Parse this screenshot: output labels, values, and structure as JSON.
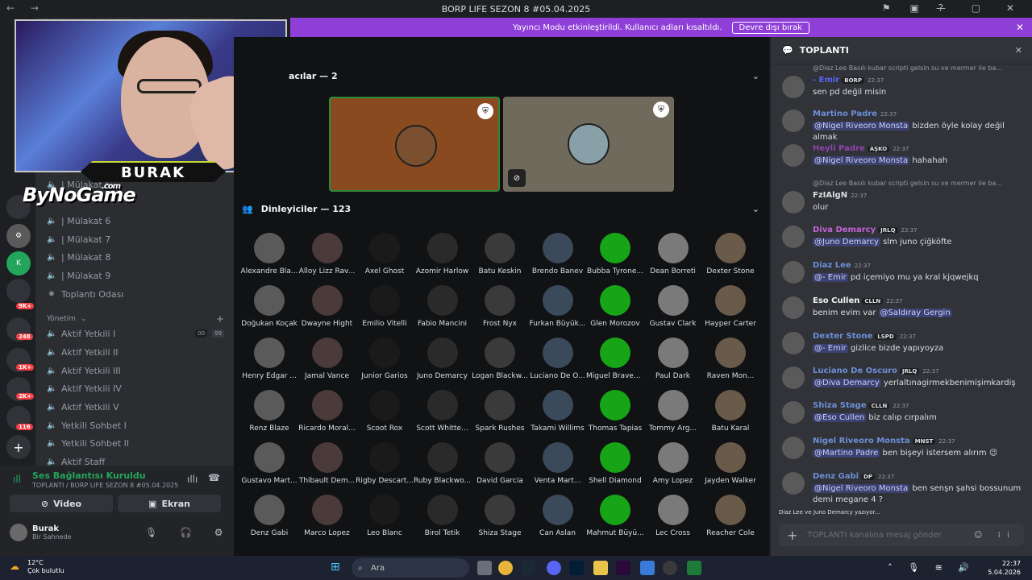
{
  "window": {
    "title": "BORP LIFE SEZON 8 #05.04.2025"
  },
  "banner": {
    "text": "Yayıncı Modu etkinleştirildi. Kullanıcı adları kısaltıldı.",
    "button": "Devre dışı bırak"
  },
  "servers": {
    "badges": [
      "9K+",
      "248",
      "1K+",
      "2K+",
      "116"
    ]
  },
  "channels": {
    "voice_items": [
      "| Mülakat 6",
      "| Mülakat 7",
      "| Mülakat 8",
      "| Mülakat 9",
      "Toplantı Odası"
    ],
    "category": "Yönetim",
    "mgmt_items": [
      "Aktif Yetkili I",
      "Aktif Yetkili II",
      "Aktif Yetkili III",
      "Aktif Yetkili IV",
      "Aktif Yetkili V",
      "Yetkili Sohbet I",
      "Yetkili Sohbet II",
      "Aktif Staff"
    ],
    "counters": [
      "00",
      "99"
    ],
    "partial_item": "| Mülakat 5"
  },
  "overlay": {
    "cam_name": "BURAK",
    "logo": "ByNoGame",
    "logo_suffix": ".com"
  },
  "voice": {
    "status": "Ses Bağlantısı Kuruldu",
    "channel": "TOPLANTI / BORP LIFE SEZON 8 #05.04.2025",
    "video_label": "Video",
    "screen_label": "Ekran",
    "user_name": "Burak",
    "user_status": "Bir Sahnede"
  },
  "stage": {
    "speakers_header": "acılar — 2",
    "listeners_header": "Dinleyiciler — 123",
    "listeners": [
      "Alexandre Bla...",
      "Alloy Lizz Rav...",
      "Axel Ghost",
      "Azomir Harlow",
      "Batu Keskin",
      "Brendo Banev",
      "Bubba Tyrone...",
      "Dean Borreti",
      "Dexter Stone",
      "Doğukan Koçak",
      "Dwayne Hight",
      "Emilio Vitelli",
      "Fabio Mancini",
      "Frost Nyx",
      "Furkan Büyük...",
      "Glen Morozov",
      "Gustav Clark",
      "Hayper Carter",
      "Henry Edgar ...",
      "Jamal Vance",
      "Junior Garios",
      "Juno Demarcy",
      "Logan Blackw...",
      "Luciano De O...",
      "Miguel Braven...",
      "Paul Dark",
      "Raven Mon...",
      "Renz Blaze",
      "Ricardo Moral...",
      "Scoot Rox",
      "Scott Whitte...",
      "Spark Rushes",
      "Takami Willims",
      "Thomas Tapias",
      "Tommy Arg...",
      "Batu Karal",
      "Gustavo Mart...",
      "Thibault Dem...",
      "Rigby Descart...",
      "Ruby Blackwo...",
      "David Garcia",
      "Venta Mart...",
      "Shell Diamond",
      "Amy Lopez",
      "Jayden Walker",
      "Denz Gabi",
      "Marco Lopez",
      "Leo Blanc",
      "Birol Tetik",
      "Shiza Stage",
      "Can Aslan",
      "Mahmut Büyü...",
      "Lec Cross",
      "Reacher Cole"
    ]
  },
  "chat": {
    "title": "TOPLANTI",
    "messages": [
      {
        "reply": "@Diaz Lee Basılı kubar scripti gelsin su ve mermer ile ba...",
        "name": "- Emir",
        "tag": "BORP",
        "time": "22:37",
        "text": "sen pd değil misin",
        "color": "#5865f2"
      },
      {
        "name": "Martino Padre",
        "time": "22:37",
        "mention": "@Nigel Riveoro Monsta",
        "text": " bizden öyle kolay değil almak",
        "color": "#6c8fd8"
      },
      {
        "name": "Heyli Padre",
        "tag": "AŞKO",
        "time": "22:37",
        "mention": "@Nigel Riveoro Monsta",
        "text": " hahahah",
        "color": "#8e44ad"
      },
      {
        "reply": "@Diaz Lee Basılı kubar scripti gelsin su ve mermer ile ba...",
        "name": "FzIAlgN",
        "time": "22:37",
        "text": "olur",
        "color": "#dbdee1"
      },
      {
        "name": "Diva Demarcy",
        "tag": "JRLQ",
        "time": "22:37",
        "mention": "@Juno Demarcy",
        "text": " slm juno çiğköfte",
        "color": "#c264d6"
      },
      {
        "name": "Diaz Lee",
        "time": "22:37",
        "mention": "@- Emir",
        "text": " pd içemiyo mu ya kral kjqwejkq",
        "color": "#6c8fd8"
      },
      {
        "name": "Eso Cullen",
        "tag": "CLLN",
        "time": "22:37",
        "text": "benim evim var ",
        "mention2": "@Saldıray Gergin",
        "color": "#f2f3f5"
      },
      {
        "name": "Dexter Stone",
        "tag": "LSPD",
        "time": "22:37",
        "mention": "@- Emir",
        "text": " gizlice bizde yapıyoyza",
        "color": "#6c8fd8"
      },
      {
        "name": "Luciano De Oscuro",
        "tag": "JRLQ",
        "time": "22:37",
        "mention": "@Diva Demarcy",
        "text": " yerlaltınagirmekbenimişimkardiş",
        "color": "#6c8fd8"
      },
      {
        "name": "Shiza Stage",
        "tag": "CLLN",
        "time": "22:37",
        "mention": "@Eso Cullen",
        "text": " biz calıp cırpalım",
        "color": "#6c8fd8"
      },
      {
        "name": "Nigel Riveoro Monsta",
        "tag": "MNST",
        "time": "22:37",
        "mention": "@Martino Padre",
        "text": " ben bişeyi istersem alırım 😉",
        "color": "#6c8fd8"
      },
      {
        "name": "Denz Gabi",
        "tag": "DP",
        "time": "22:37",
        "mention": "@Nigel Riveoro Monsta",
        "text": " ben senşn şahsi bossunum demi megane 4 ?",
        "color": "#6c8fd8"
      }
    ],
    "typing": "Diaz Lee ve Juno Demarcy yazıyor...",
    "input_placeholder": "TOPLANTI kanalına mesaj gönder"
  },
  "taskbar": {
    "temp": "12°C",
    "weather": "Çok bulutlu",
    "search": "Ara",
    "time": "22:37",
    "date": "5.04.2026"
  }
}
